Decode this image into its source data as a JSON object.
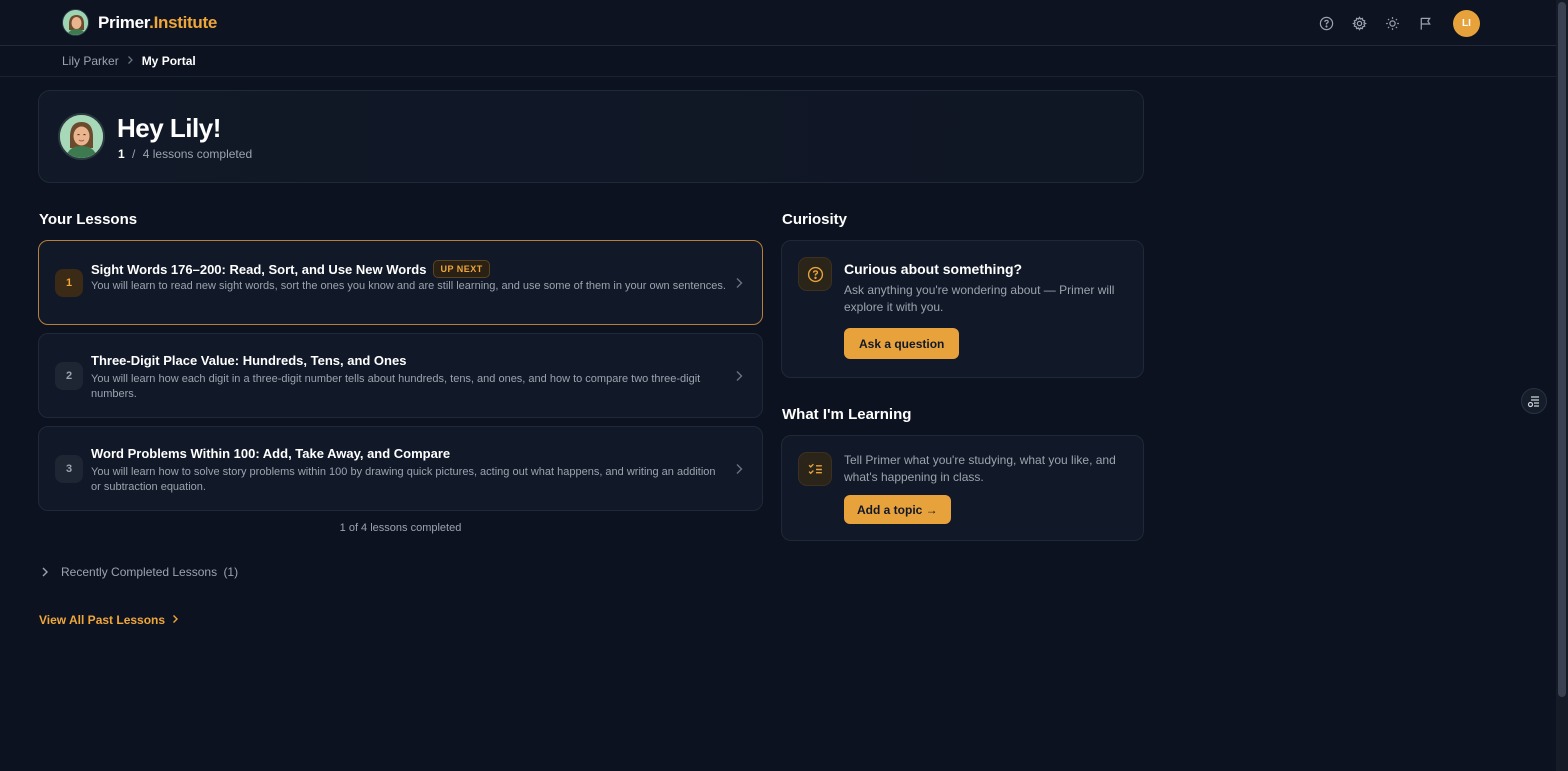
{
  "header": {
    "brand_primary": "Primer",
    "brand_secondary": ".Institute",
    "user_initials": "LI",
    "icons": [
      "help-icon",
      "settings-icon",
      "theme-sun-icon",
      "flag-icon"
    ]
  },
  "breadcrumb": {
    "parent": "Lily Parker",
    "current": "My Portal"
  },
  "hero": {
    "greeting": "Hey Lily!",
    "completed": "1",
    "separator": "/",
    "total_text": "4 lessons completed"
  },
  "lessons": {
    "heading": "Your Lessons",
    "items": [
      {
        "number": "1",
        "title": "Sight Words 176–200: Read, Sort, and Use New Words",
        "badge": "UP NEXT",
        "description": "You will learn to read new sight words, sort the ones you know and are still learning, and use some of them in your own sentences."
      },
      {
        "number": "2",
        "title": "Three-Digit Place Value: Hundreds, Tens, and Ones",
        "description": "You will learn how each digit in a three-digit number tells about hundreds, tens, and ones, and how to compare two three-digit numbers."
      },
      {
        "number": "3",
        "title": "Word Problems Within 100: Add, Take Away, and Compare",
        "description": "You will learn how to solve story problems within 100 by drawing quick pictures, acting out what happens, and writing an addition or subtraction equation."
      }
    ],
    "progress_note": "1 of 4 lessons completed",
    "recent_label": "Recently Completed Lessons",
    "recent_count": "(1)",
    "view_all": "View All Past Lessons"
  },
  "curiosity": {
    "heading": "Curiosity",
    "title": "Curious about something?",
    "text": "Ask anything you're wondering about — Primer will explore it with you.",
    "button": "Ask a question"
  },
  "learning": {
    "heading": "What I'm Learning",
    "text": "Tell Primer what you're studying, what you like, and what's happening in class.",
    "button": "Add a topic →"
  },
  "colors": {
    "accent": "#e8a23c",
    "background": "#0c1220",
    "card": "#111827"
  }
}
